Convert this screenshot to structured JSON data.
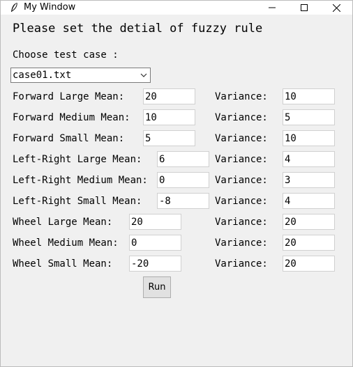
{
  "window": {
    "title": "My Window"
  },
  "heading": "Please set the detial of fuzzy rule",
  "test_case": {
    "label": "Choose test case :",
    "selected": "case01.txt"
  },
  "rows": [
    {
      "label": "Forward Large Mean:",
      "mean": "20",
      "variance_label": "Variance:",
      "variance": "10"
    },
    {
      "label": "Forward Medium Mean:",
      "mean": "10",
      "variance_label": "Variance:",
      "variance": "5"
    },
    {
      "label": "Forward Small Mean:",
      "mean": "5",
      "variance_label": "Variance:",
      "variance": "10"
    },
    {
      "label": "Left-Right Large Mean:",
      "mean": "6",
      "variance_label": "Variance:",
      "variance": "4"
    },
    {
      "label": "Left-Right Medium Mean:",
      "mean": "0",
      "variance_label": "Variance:",
      "variance": "3"
    },
    {
      "label": "Left-Right Small Mean:",
      "mean": "-8",
      "variance_label": "Variance:",
      "variance": "4"
    },
    {
      "label": "Wheel Large Mean:",
      "mean": "20",
      "variance_label": "Variance:",
      "variance": "20"
    },
    {
      "label": "Wheel Medium Mean:",
      "mean": "0",
      "variance_label": "Variance:",
      "variance": "20"
    },
    {
      "label": "Wheel Small Mean:",
      "mean": "-20",
      "variance_label": "Variance:",
      "variance": "20"
    }
  ],
  "run_button": "Run"
}
